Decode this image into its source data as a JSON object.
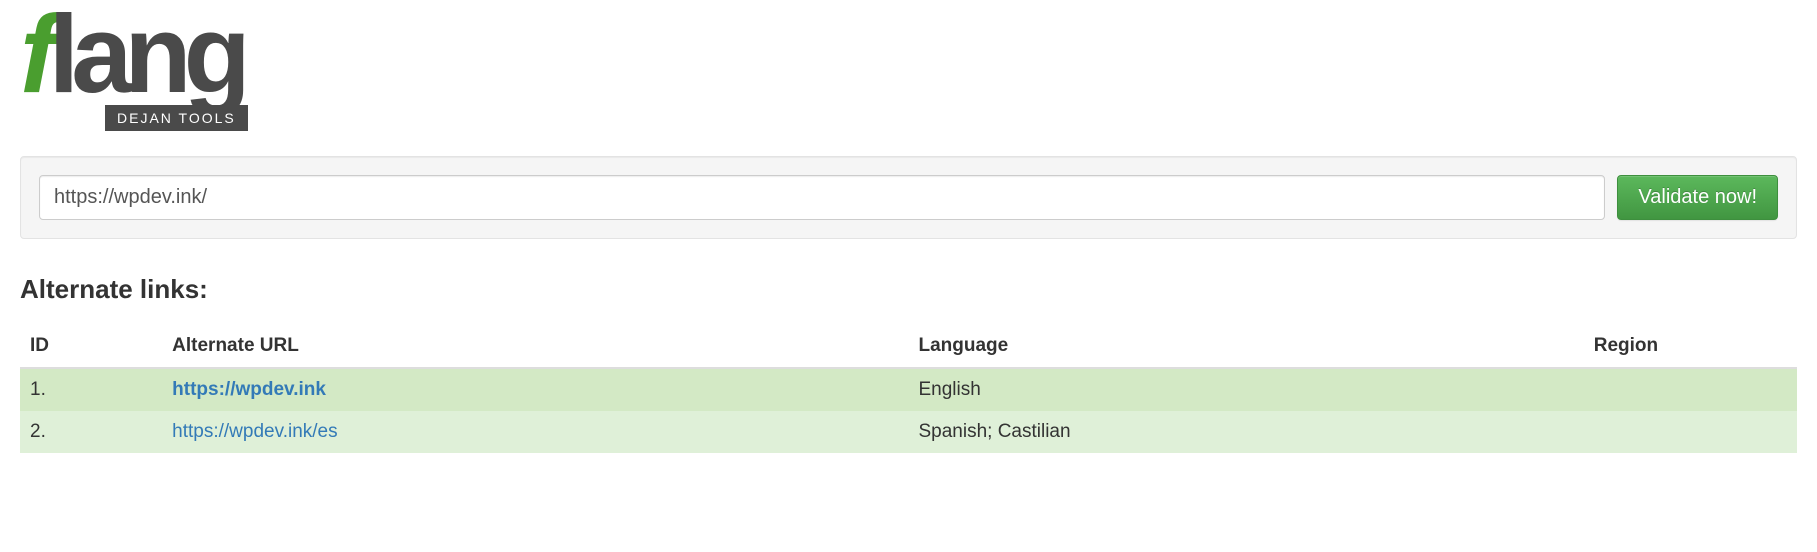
{
  "logo": {
    "f": "f",
    "lang": "lang",
    "subtitle": "DEJAN TOOLS"
  },
  "search": {
    "url_value": "https://wpdev.ink/",
    "button_label": "Validate now!"
  },
  "section_title": "Alternate links:",
  "table": {
    "headers": {
      "id": "ID",
      "url": "Alternate URL",
      "language": "Language",
      "region": "Region"
    },
    "rows": [
      {
        "id": "1.",
        "url": "https://wpdev.ink",
        "language": "English",
        "region": "",
        "bold": true
      },
      {
        "id": "2.",
        "url": "https://wpdev.ink/es",
        "language": "Spanish; Castilian",
        "region": "",
        "bold": false
      }
    ]
  }
}
